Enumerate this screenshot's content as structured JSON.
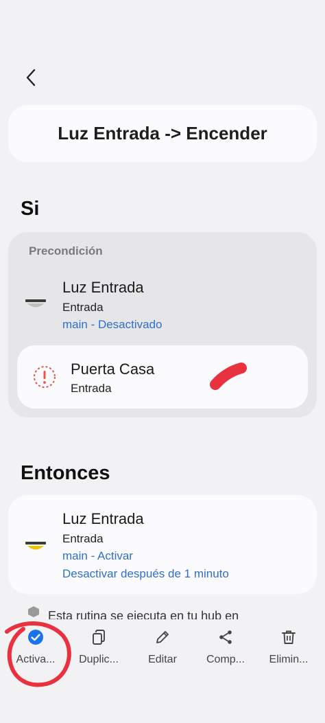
{
  "header": {
    "back_icon": "chevron-left-icon"
  },
  "routine": {
    "title": "Luz Entrada -> Encender"
  },
  "if_section": {
    "title": "Si",
    "precondition_label": "Precondición",
    "precondition": {
      "name": "Luz Entrada",
      "room": "Entrada",
      "state": "main - Desactivado",
      "icon": "ceiling-light-off-icon"
    },
    "condition": {
      "name": "Puerta Casa",
      "room": "Entrada",
      "icon": "alert-circle-icon"
    }
  },
  "then_section": {
    "title": "Entonces",
    "action": {
      "name": "Luz Entrada",
      "room": "Entrada",
      "state": "main - Activar",
      "delay": "Desactivar después de 1 minuto",
      "icon": "ceiling-light-on-icon"
    }
  },
  "info": {
    "text": "Esta rutina se ejecuta en tu hub en",
    "icon": "hub-icon"
  },
  "toolbar": {
    "activate": "Activa...",
    "duplicate": "Duplic...",
    "edit": "Editar",
    "share": "Comp...",
    "delete": "Elimin..."
  },
  "colors": {
    "accent_blue": "#2f6fc8",
    "check_blue": "#1a73e8",
    "alert_red": "#e5534b",
    "light_on": "#f2c400",
    "annotation_red": "#e8323f"
  }
}
